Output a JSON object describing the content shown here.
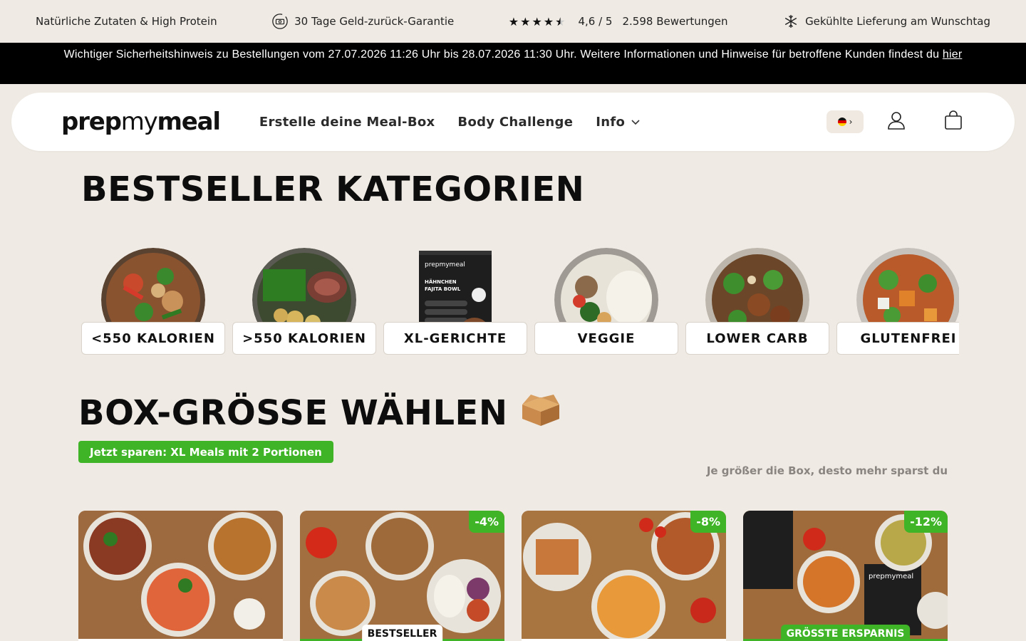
{
  "usp": {
    "item1": "Natürliche Zutaten & High Protein",
    "item2": "30 Tage Geld-zurück-Garantie",
    "rating": "4,6 / 5",
    "reviews": "2.598 Bewertungen",
    "item4": "Gekühlte Lieferung am Wunschtag"
  },
  "notice": {
    "text": "Wichtiger Sicherheitshinweis zu Bestellungen vom 27.07.2026 11:26 Uhr bis 28.07.2026 11:30 Uhr. Weitere Informationen und Hinweise für betroffene Kunden findest du",
    "link": "hier"
  },
  "header": {
    "logo_bold": "prep",
    "logo_light": "my",
    "logo_bold2": "meal",
    "nav": {
      "mealbox": "Erstelle deine Meal-Box",
      "challenge": "Body Challenge",
      "info": "Info"
    }
  },
  "bestseller": {
    "title": "BESTSELLER KATEGORIEN",
    "categories": [
      {
        "label": "<550 KALORIEN"
      },
      {
        "label": ">550 KALORIEN"
      },
      {
        "label": "XL-GERICHTE"
      },
      {
        "label": "VEGGIE"
      },
      {
        "label": "LOWER CARB"
      },
      {
        "label": "GLUTENFREI"
      }
    ]
  },
  "box": {
    "title": "BOX-GRÖSSE WÄHLEN",
    "promo": "Jetzt sparen: XL Meals mit 2 Portionen",
    "hint": "Je größer die Box, desto mehr sparst du",
    "cards": [
      {
        "discount": "",
        "tag": ""
      },
      {
        "discount": "-4%",
        "tag": "BESTSELLER"
      },
      {
        "discount": "-8%",
        "tag": ""
      },
      {
        "discount": "-12%",
        "tag": "GRÖSSTE ERSPARNIS"
      }
    ]
  },
  "colors": {
    "accent_green": "#3fb427",
    "background": "#efeae3",
    "notice_bg": "#000000"
  },
  "icons": [
    "money-back-icon",
    "star-icon",
    "snowflake-icon",
    "chevron-down-icon",
    "user-icon",
    "cart-icon",
    "box-emoji-icon"
  ]
}
